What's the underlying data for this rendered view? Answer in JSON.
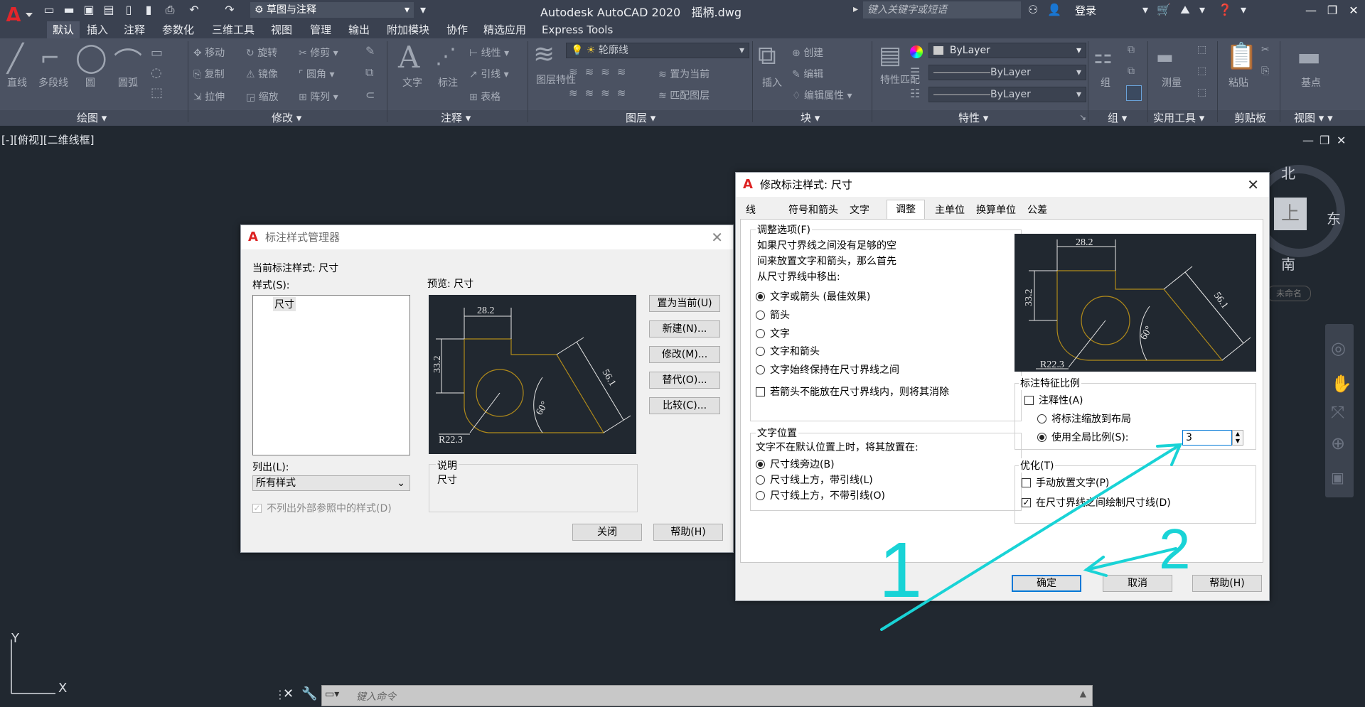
{
  "app": {
    "title": "Autodesk AutoCAD 2020",
    "file": "摇柄.dwg",
    "workspace": "草图与注释",
    "search_placeholder": "键入关键字或短语",
    "login": "登录"
  },
  "tabs": [
    "默认",
    "插入",
    "注释",
    "参数化",
    "三维工具",
    "视图",
    "管理",
    "输出",
    "附加模块",
    "协作",
    "精选应用",
    "Express Tools"
  ],
  "ribbon": {
    "draw": {
      "items": [
        "直线",
        "多段线",
        "圆",
        "圆弧"
      ],
      "label": "绘图"
    },
    "modify": {
      "items": [
        "移动",
        "旋转",
        "修剪",
        "复制",
        "镜像",
        "圆角",
        "拉伸",
        "缩放",
        "阵列"
      ],
      "label": "修改"
    },
    "annotation": {
      "items": [
        "文字",
        "标注",
        "线性",
        "引线",
        "表格"
      ],
      "label": "注释"
    },
    "layers": {
      "items": [
        "图层特性",
        "置为当前",
        "匹配图层"
      ],
      "layer_value": "轮廓线",
      "label": "图层"
    },
    "block": {
      "items": [
        "插入",
        "创建",
        "编辑",
        "编辑属性"
      ],
      "label": "块"
    },
    "properties": {
      "items": [
        "特性匹配"
      ],
      "color": "ByLayer",
      "linetype": "ByLayer",
      "lineweight": "ByLayer",
      "label": "特性"
    },
    "groups": {
      "items": [
        "组"
      ],
      "label": "组"
    },
    "utilities": {
      "items": [
        "测量"
      ],
      "label": "实用工具"
    },
    "clipboard": {
      "items": [
        "粘贴"
      ],
      "label": "剪贴板"
    },
    "view": {
      "items": [
        "基点"
      ],
      "label": "视图"
    }
  },
  "viewport": {
    "label": "[-][俯视][二维线框]",
    "viewcube": {
      "north": "北",
      "south": "南",
      "east": "东",
      "top": "上",
      "wcs": "未命名"
    },
    "ucs_y": "Y",
    "ucs_x": "X"
  },
  "cmdline": {
    "placeholder": "键入命令"
  },
  "manager": {
    "title": "标注样式管理器",
    "current_label": "当前标注样式: 尺寸",
    "styles_label": "样式(S):",
    "styles": [
      "尺寸"
    ],
    "preview_label": "预览: 尺寸",
    "buttons": [
      "置为当前(U)",
      "新建(N)...",
      "修改(M)...",
      "替代(O)...",
      "比较(C)..."
    ],
    "list_label": "列出(L):",
    "list_value": "所有样式",
    "no_xref_label": "不列出外部参照中的样式(D)",
    "desc_label": "说明",
    "desc_value": "尺寸",
    "close": "关闭",
    "help": "帮助(H)"
  },
  "modify": {
    "title": "修改标注样式: 尺寸",
    "tabs": [
      "线",
      "符号和箭头",
      "文字",
      "调整",
      "主单位",
      "换算单位",
      "公差"
    ],
    "fit_group": "调整选项(F)",
    "fit_desc_1": "如果尺寸界线之间没有足够的空",
    "fit_desc_2": "间来放置文字和箭头，那么首先",
    "fit_desc_3": "从尺寸界线中移出:",
    "fit_options": [
      "文字或箭头 (最佳效果)",
      "箭头",
      "文字",
      "文字和箭头",
      "文字始终保持在尺寸界线之间"
    ],
    "suppress_arrows": "若箭头不能放在尺寸界线内，则将其消除",
    "textpos_group": "文字位置",
    "textpos_desc": "文字不在默认位置上时，将其放置在:",
    "textpos_options": [
      "尺寸线旁边(B)",
      "尺寸线上方，带引线(L)",
      "尺寸线上方，不带引线(O)"
    ],
    "scale_group": "标注特征比例",
    "annotative": "注释性(A)",
    "scale_layout": "将标注缩放到布局",
    "scale_global": "使用全局比例(S):",
    "scale_value": "3",
    "fine_group": "优化(T)",
    "manual_text": "手动放置文字(P)",
    "draw_dimline": "在尺寸界线之间绘制尺寸线(D)",
    "ok": "确定",
    "cancel": "取消",
    "help": "帮助(H)"
  },
  "preview_dims": {
    "width": "28.2",
    "height": "33.2",
    "slant": "56.1",
    "angle": "60°",
    "radius": "R22.3"
  },
  "annotations": {
    "mark1": "1",
    "mark2": "2"
  },
  "colors": {
    "accent": "#0078d7",
    "cyan": "#19d3d6",
    "drawing_bg": "#212830",
    "ribbon_bg": "#4b5262"
  }
}
